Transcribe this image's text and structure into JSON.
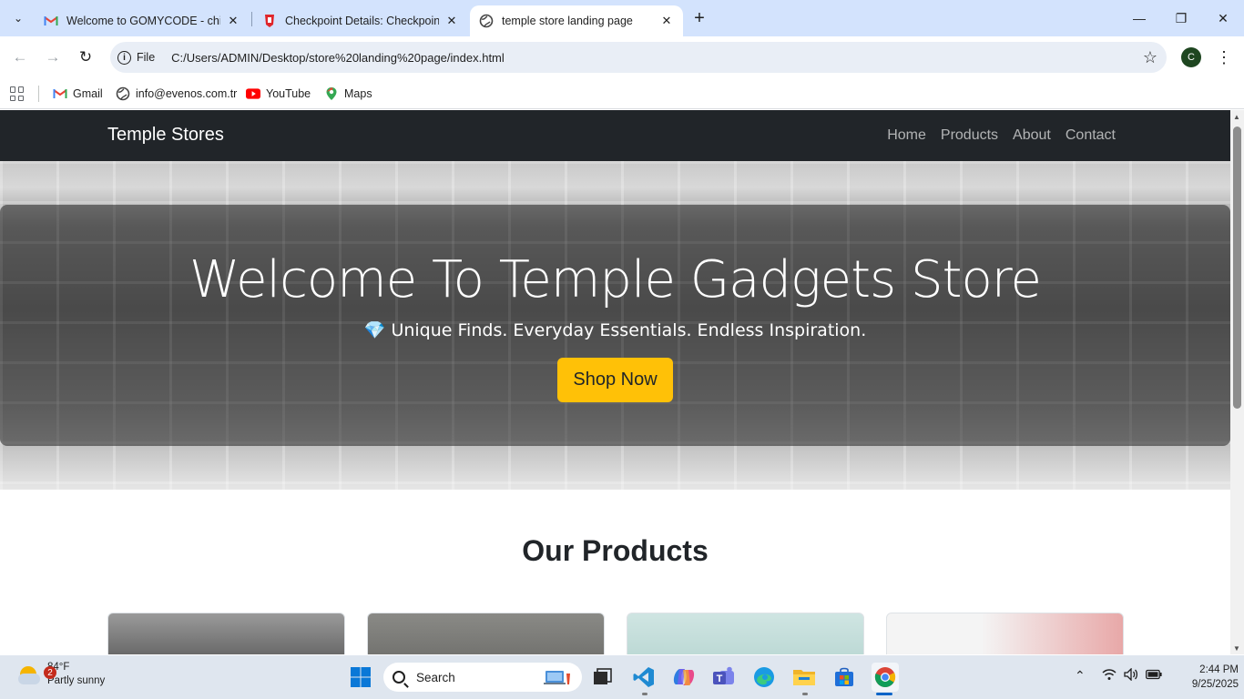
{
  "browser": {
    "tabs": [
      {
        "title": "Welcome to GOMYCODE - chiji",
        "icon": "gmail-icon",
        "active": false
      },
      {
        "title": "Checkpoint Details: Checkpoint",
        "icon": "gomycode-icon",
        "active": false
      },
      {
        "title": "temple store landing page",
        "icon": "globe-icon",
        "active": true
      }
    ],
    "address_chip": "File",
    "url": "C:/Users/ADMIN/Desktop/store%20landing%20page/index.html",
    "profile_initial": "C",
    "bookmarks": [
      {
        "label": "Gmail",
        "icon": "gmail-icon"
      },
      {
        "label": "info@evenos.com.tr",
        "icon": "globe-icon"
      },
      {
        "label": "YouTube",
        "icon": "youtube-icon"
      },
      {
        "label": "Maps",
        "icon": "maps-icon"
      }
    ]
  },
  "site": {
    "brand": "Temple Stores",
    "nav": [
      "Home",
      "Products",
      "About",
      "Contact"
    ],
    "hero": {
      "title": "Welcome To Temple Gadgets Store",
      "subtitle_icon": "💎",
      "subtitle": "Unique Finds. Everyday Essentials. Endless Inspiration.",
      "cta": "Shop Now"
    },
    "products_heading": "Our Products",
    "accent": "#ffc107",
    "navbar_bg": "#212529"
  },
  "taskbar": {
    "weather": {
      "temp": "84°F",
      "condition": "Partly sunny",
      "badge": "2"
    },
    "search_placeholder": "Search",
    "time": "2:44 PM",
    "date": "9/25/2025"
  }
}
